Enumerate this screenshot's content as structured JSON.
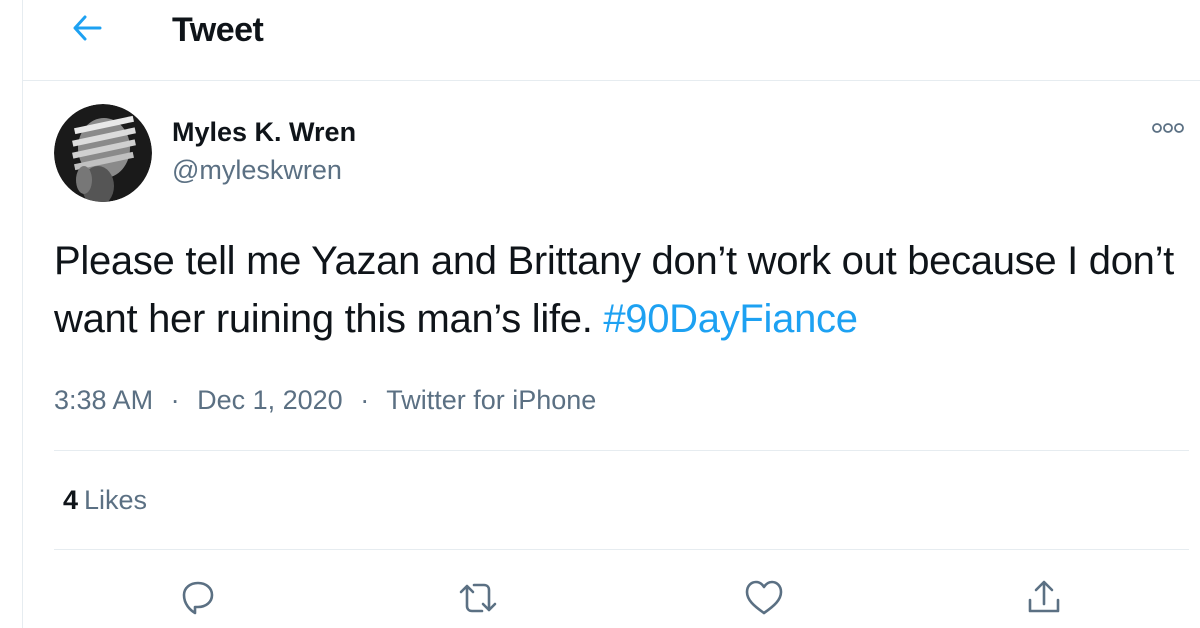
{
  "header": {
    "title": "Tweet",
    "back_icon": "arrow-left-icon"
  },
  "author": {
    "display_name": "Myles K. Wren",
    "handle": "@myleskwren"
  },
  "tweet": {
    "text": "Please tell me Yazan and Brittany don’t work out because I don’t want her ruining this man’s life. ",
    "hashtag": "#90DayFiance",
    "time": "3:38 AM",
    "date": "Dec 1, 2020",
    "source": "Twitter for iPhone",
    "separator": "·"
  },
  "stats": {
    "likes_count": "4",
    "likes_label": "Likes"
  },
  "actions": {
    "reply_icon": "reply-icon",
    "retweet_icon": "retweet-icon",
    "like_icon": "heart-icon",
    "share_icon": "share-icon",
    "more_icon": "more-options-icon"
  },
  "colors": {
    "accent": "#1da1f2",
    "text": "#0f1419",
    "secondary": "#5b7083",
    "border": "#e6ecf0"
  }
}
